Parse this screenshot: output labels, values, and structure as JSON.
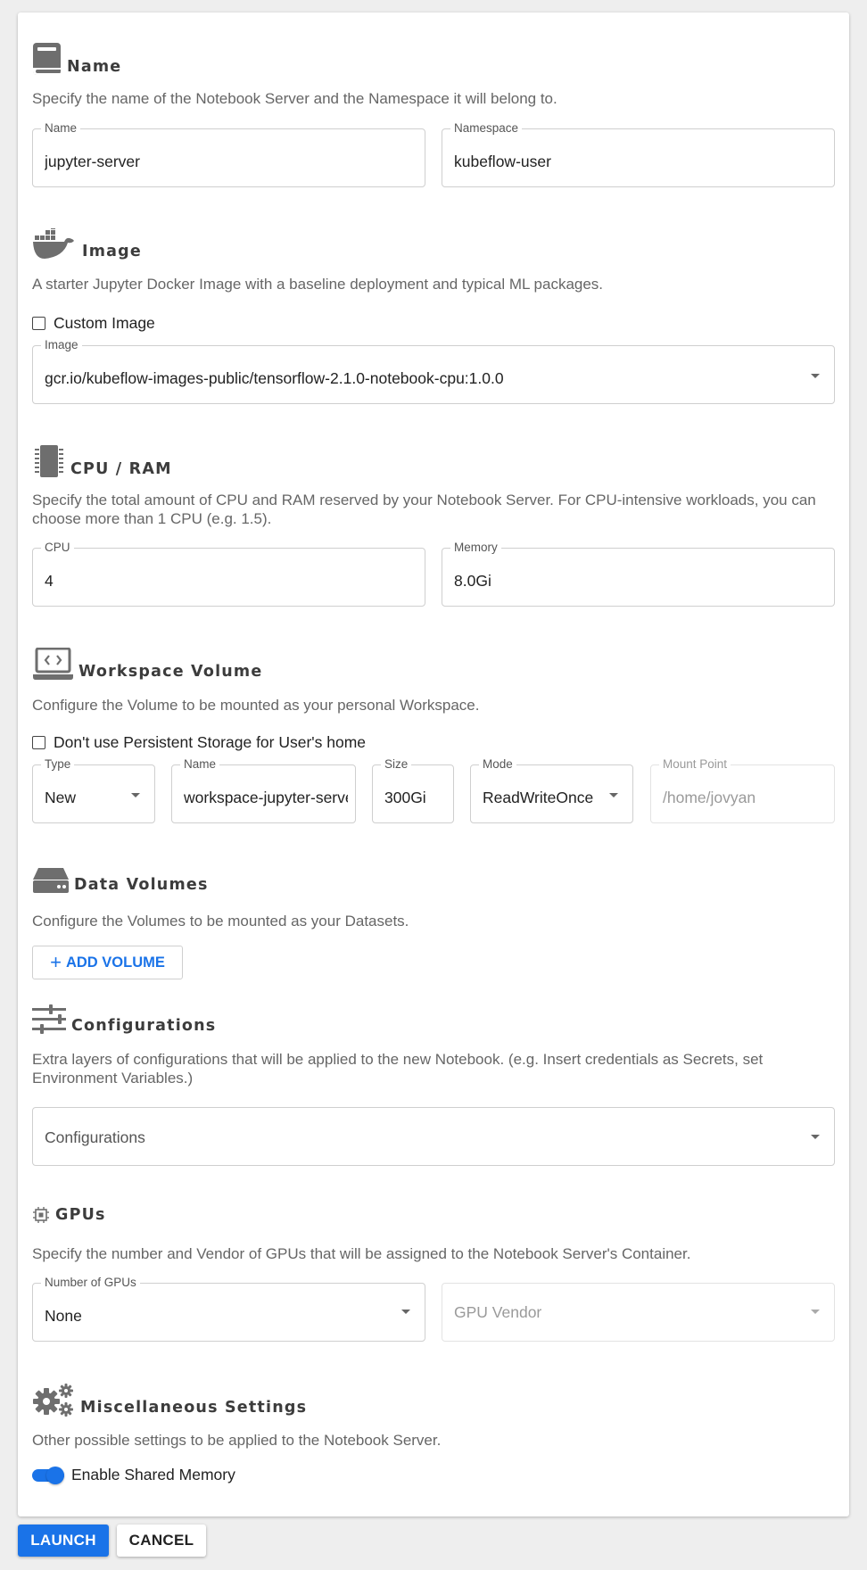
{
  "sections": {
    "name": {
      "title": "Name",
      "icon": "book-icon",
      "description": "Specify the name of the Notebook Server and the Namespace it will belong to.",
      "name_field": {
        "label": "Name",
        "value": "jupyter-server"
      },
      "namespace_field": {
        "label": "Namespace",
        "value": "kubeflow-user"
      }
    },
    "image": {
      "title": "Image",
      "icon": "docker-icon",
      "description": "A starter Jupyter Docker Image with a baseline deployment and typical ML packages.",
      "custom_image_label": "Custom Image",
      "image_field": {
        "label": "Image",
        "value": "gcr.io/kubeflow-images-public/tensorflow-2.1.0-notebook-cpu:1.0.0"
      }
    },
    "cpu_ram": {
      "title": "CPU / RAM",
      "icon": "memory-chip-icon",
      "description": "Specify the total amount of CPU and RAM reserved by your Notebook Server. For CPU-intensive workloads, you can choose more than 1 CPU (e.g. 1.5).",
      "cpu_field": {
        "label": "CPU",
        "value": "4"
      },
      "memory_field": {
        "label": "Memory",
        "value": "8.0Gi"
      }
    },
    "workspace": {
      "title": "Workspace Volume",
      "icon": "laptop-code-icon",
      "description": "Configure the Volume to be mounted as your personal Workspace.",
      "no_persistent_label": "Don't use Persistent Storage for User's home",
      "type_field": {
        "label": "Type",
        "value": "New"
      },
      "name_field": {
        "label": "Name",
        "value": "workspace-jupyter-server"
      },
      "size_field": {
        "label": "Size",
        "value": "300Gi"
      },
      "mode_field": {
        "label": "Mode",
        "value": "ReadWriteOnce"
      },
      "mount_field": {
        "label": "Mount Point",
        "placeholder": "/home/jovyan"
      }
    },
    "data_volumes": {
      "title": "Data Volumes",
      "icon": "hard-drive-icon",
      "description": "Configure the Volumes to be mounted as your Datasets.",
      "add_volume_label": "ADD VOLUME"
    },
    "configurations": {
      "title": "Configurations",
      "icon": "sliders-icon",
      "description": "Extra layers of configurations that will be applied to the new Notebook. (e.g. Insert credentials as Secrets, set Environment Variables.)",
      "select_placeholder": "Configurations"
    },
    "gpus": {
      "title": "GPUs",
      "icon": "gpu-chip-icon",
      "description": "Specify the number and Vendor of GPUs that will be assigned to the Notebook Server's Container.",
      "num_gpus_field": {
        "label": "Number of GPUs",
        "value": "None"
      },
      "vendor_placeholder": "GPU Vendor"
    },
    "misc": {
      "title": "Miscellaneous Settings",
      "icon": "gears-icon",
      "description": "Other possible settings to be applied to the Notebook Server.",
      "shared_memory_label": "Enable Shared Memory",
      "shared_memory_enabled": true
    }
  },
  "footer": {
    "launch_label": "LAUNCH",
    "cancel_label": "CANCEL"
  },
  "colors": {
    "accent": "#1a73e8",
    "icon_gray": "#6e6e6e",
    "background": "#eeeeee"
  }
}
